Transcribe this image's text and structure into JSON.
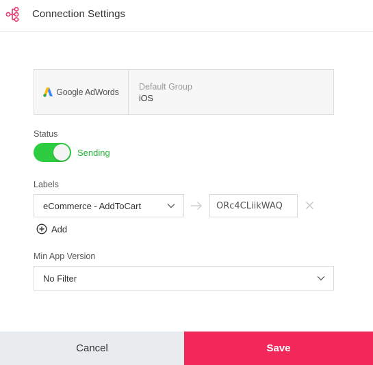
{
  "header": {
    "title": "Connection Settings",
    "icon": "connection-icon"
  },
  "connection": {
    "provider": "Google AdWords",
    "group": "Default Group",
    "platform": "iOS"
  },
  "status": {
    "label": "Status",
    "text": "Sending",
    "enabled": true,
    "color": "#2ecc40"
  },
  "labels": {
    "label": "Labels",
    "event": "eCommerce - AddToCart",
    "code": "ORc4CLiikWAQ",
    "add_label": "Add"
  },
  "min_version": {
    "label": "Min App Version",
    "value": "No Filter"
  },
  "footer": {
    "cancel_label": "Cancel",
    "save_label": "Save",
    "save_color": "#f2285a"
  }
}
